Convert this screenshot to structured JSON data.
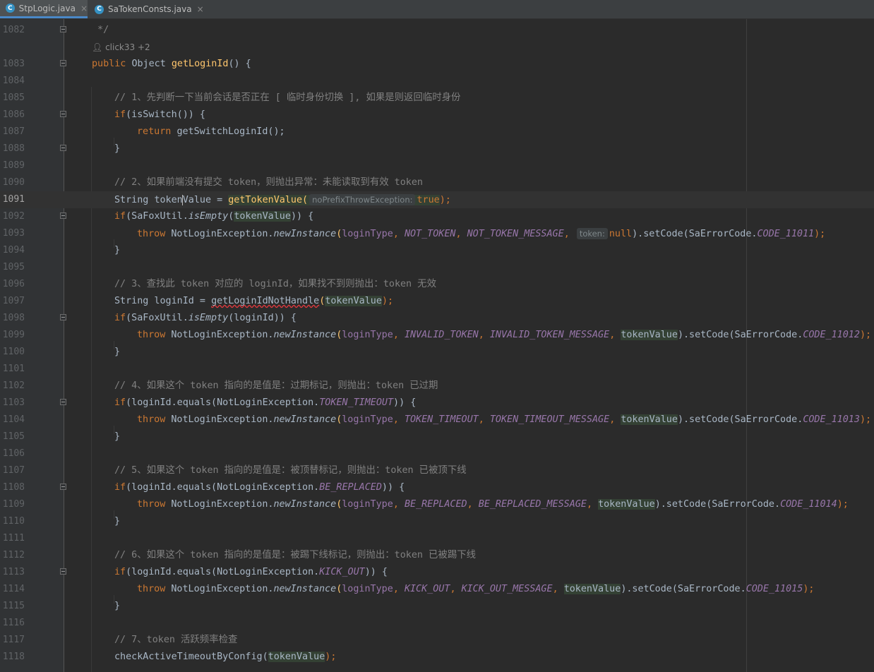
{
  "tabs": [
    {
      "icon": "java-class-icon",
      "icon_letter": "C",
      "name": "StpLogic.java",
      "active": true
    },
    {
      "icon": "java-class-icon",
      "icon_letter": "C",
      "name": "SaTokenConsts.java",
      "active": false
    }
  ],
  "editor": {
    "current_line": "1091",
    "author_hint": "click33 +2",
    "lines": {
      "l1082": "1082",
      "l1083": "1083",
      "l1084": "1084",
      "l1085": "1085",
      "l1086": "1086",
      "l1087": "1087",
      "l1088": "1088",
      "l1089": "1089",
      "l1090": "1090",
      "l1091": "1091",
      "l1092": "1092",
      "l1093": "1093",
      "l1094": "1094",
      "l1095": "1095",
      "l1096": "1096",
      "l1097": "1097",
      "l1098": "1098",
      "l1099": "1099",
      "l1100": "1100",
      "l1101": "1101",
      "l1102": "1102",
      "l1103": "1103",
      "l1104": "1104",
      "l1105": "1105",
      "l1106": "1106",
      "l1107": "1107",
      "l1108": "1108",
      "l1109": "1109",
      "l1110": "1110",
      "l1111": "1111",
      "l1112": "1112",
      "l1113": "1113",
      "l1114": "1114",
      "l1115": "1115",
      "l1116": "1116",
      "l1117": "1117",
      "l1118": "1118"
    },
    "code": {
      "c1082": " */",
      "c1083_kw": "public ",
      "c1083_type": "Object ",
      "c1083_fn": "getLoginId",
      "c1083_rest": "() {",
      "c1085": "// 1、先判断一下当前会话是否正在 [ 临时身份切换 ], 如果是则返回临时身份",
      "c1086_kw": "if",
      "c1086_rest": "(isSwitch()) {",
      "c1087_kw": "return ",
      "c1087_rest": "getSwitchLoginId();",
      "brace": "}",
      "c1090": "// 2、如果前端没有提交 token，则抛出异常：未能读取到有效 token",
      "c1091_a": "String ",
      "c1091_b": "token",
      "c1091_c": "Value",
      "c1091_d": " = ",
      "c1091_fn": "getTokenValue(",
      "c1091_hint": "noPrefixThrowException:",
      "c1091_true": "true",
      "c1091_end": ");",
      "c1092_kw": "if",
      "c1092_a": "(SaFoxUtil.",
      "c1092_m": "isEmpty",
      "c1092_b": "(",
      "c1092_v": "tokenValue",
      "c1092_c": ")) {",
      "throw": "throw ",
      "nle": "NotLoginException.",
      "newInstance": "newInstance",
      "open": "(",
      "loginType": "loginType",
      "comma": ", ",
      "c1093_s1": "NOT_TOKEN",
      "c1093_s2": "NOT_TOKEN_MESSAGE",
      "c1093_hint": "token:",
      "c1093_null": "null",
      "close_setcode": ").setCode(SaErrorCode.",
      "c1093_code": "CODE_11011",
      "end": ");",
      "c1096": "// 3、查找此 token 对应的 loginId，如果找不到则抛出：token 无效",
      "c1097_a": "String loginId = ",
      "c1097_fn": "getLoginIdNotHandle",
      "c1097_b": "(",
      "c1097_v": "tokenValue",
      "c1097_c": ");",
      "c1098_a": "(SaFoxUtil.",
      "c1098_b": "(loginId)) {",
      "tokenValue": "tokenValue",
      "c1099_s1": "INVALID_TOKEN",
      "c1099_s2": "INVALID_TOKEN_MESSAGE",
      "c1099_code": "CODE_11012",
      "c1102": "// 4、如果这个 token 指向的是值是：过期标记，则抛出：token 已过期",
      "c1103_a": "(loginId.equals(NotLoginException.",
      "c1103_s": "TOKEN_TIMEOUT",
      "c1103_b": ")) {",
      "c1104_s1": "TOKEN_TIMEOUT",
      "c1104_s2": "TOKEN_TIMEOUT_MESSAGE",
      "c1104_code": "CODE_11013",
      "c1107": "// 5、如果这个 token 指向的是值是：被顶替标记，则抛出：token 已被顶下线",
      "c1108_s": "BE_REPLACED",
      "c1109_s1": "BE_REPLACED",
      "c1109_s2": "BE_REPLACED_MESSAGE",
      "c1109_code": "CODE_11014",
      "c1112": "// 6、如果这个 token 指向的是值是：被踢下线标记，则抛出：token 已被踢下线",
      "c1113_s": "KICK_OUT",
      "c1114_s1": "KICK_OUT",
      "c1114_s2": "KICK_OUT_MESSAGE",
      "c1114_code": "CODE_11015",
      "c1117": "// 7、token 活跃频率检查",
      "c1118_a": "checkActiveTimeoutByConfig(",
      "c1118_v": "tokenValue",
      "c1118_b": ");"
    }
  },
  "colors": {
    "keyword": "#cc7832",
    "function": "#ffc66d",
    "comment": "#808080",
    "static_field": "#9876aa",
    "text": "#a9b7c6",
    "background": "#2b2b2b",
    "gutter": "#313335"
  }
}
